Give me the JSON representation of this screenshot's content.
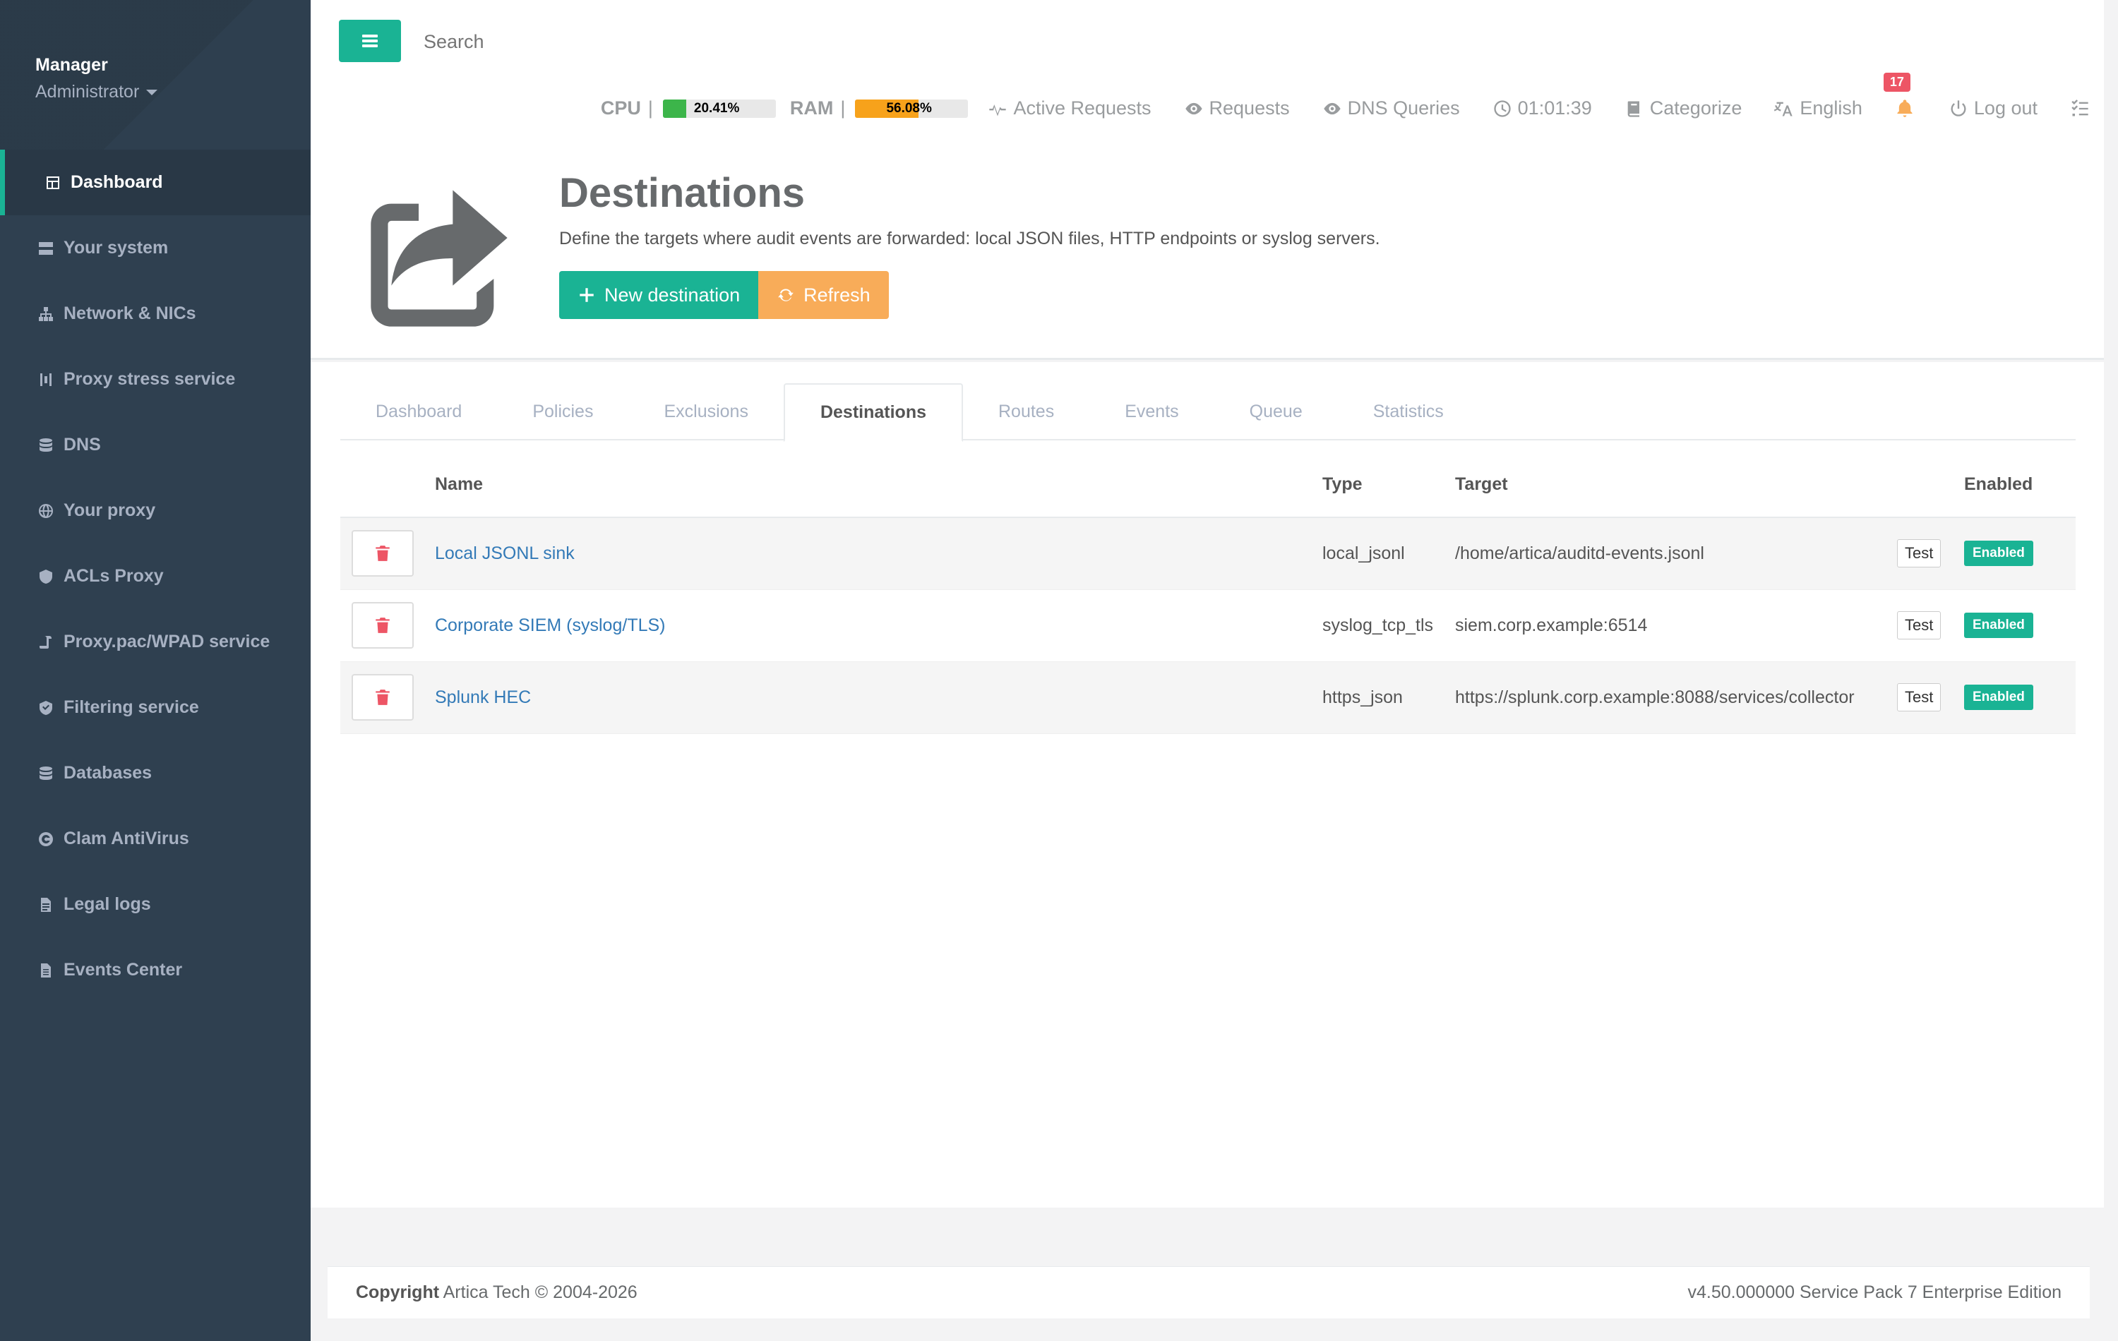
{
  "profile": {
    "name": "Manager",
    "role": "Administrator"
  },
  "sidebar": {
    "items": [
      {
        "label": "Dashboard",
        "icon": "dashboard-icon",
        "active": true
      },
      {
        "label": "Your system",
        "icon": "server-icon"
      },
      {
        "label": "Network & NICs",
        "icon": "sitemap-icon"
      },
      {
        "label": "Proxy stress service",
        "icon": "stress-icon"
      },
      {
        "label": "DNS",
        "icon": "database-icon"
      },
      {
        "label": "Your proxy",
        "icon": "globe-icon"
      },
      {
        "label": "ACLs Proxy",
        "icon": "shield-icon"
      },
      {
        "label": "Proxy.pac/WPAD service",
        "icon": "script-icon"
      },
      {
        "label": "Filtering service",
        "icon": "shield-check-icon"
      },
      {
        "label": "Databases",
        "icon": "database-icon"
      },
      {
        "label": "Clam AntiVirus",
        "icon": "antivirus-icon"
      },
      {
        "label": "Legal logs",
        "icon": "file-icon"
      },
      {
        "label": "Events Center",
        "icon": "list-file-icon"
      }
    ]
  },
  "search": {
    "placeholder": "Search"
  },
  "status": {
    "cpu_label": "CPU",
    "cpu_value": "20.41%",
    "cpu_fraction": 0.2041,
    "cpu_color": "#3cb54a",
    "ram_label": "RAM",
    "ram_value": "56.08%",
    "ram_fraction": 0.5608,
    "ram_color": "#f7a21b",
    "sep": "|",
    "active_requests": "Active Requests",
    "requests": "Requests",
    "dns_queries": "DNS Queries",
    "clock": "01:01:39",
    "categorize": "Categorize",
    "language": "English",
    "notifications": "17",
    "logout": "Log out"
  },
  "header": {
    "title": "Destinations",
    "description": "Define the targets where audit events are forwarded: local JSON files, HTTP endpoints or syslog servers.",
    "new_label": "New destination",
    "refresh_label": "Refresh"
  },
  "tabs": [
    "Dashboard",
    "Policies",
    "Exclusions",
    "Destinations",
    "Routes",
    "Events",
    "Queue",
    "Statistics"
  ],
  "active_tab": "Destinations",
  "table": {
    "headers": {
      "name": "Name",
      "type": "Type",
      "target": "Target",
      "enabled": "Enabled"
    },
    "rows": [
      {
        "name": "Local JSONL sink",
        "type": "local_jsonl",
        "target": "/home/artica/auditd-events.jsonl",
        "test": "Test",
        "enabled": "Enabled"
      },
      {
        "name": "Corporate SIEM (syslog/TLS)",
        "type": "syslog_tcp_tls",
        "target": "siem.corp.example:6514",
        "test": "Test",
        "enabled": "Enabled"
      },
      {
        "name": "Splunk HEC",
        "type": "https_json",
        "target": "https://splunk.corp.example:8088/services/collector",
        "test": "Test",
        "enabled": "Enabled"
      }
    ]
  },
  "footer": {
    "copyright_bold": "Copyright",
    "copyright_text": "Artica Tech © 2004-2026",
    "version": "v4.50.000000 Service Pack 7 Enterprise Edition"
  },
  "colors": {
    "accent": "#1ab394",
    "warning": "#f8ac59",
    "danger": "#ed5565",
    "sidebar": "#2f4050"
  }
}
